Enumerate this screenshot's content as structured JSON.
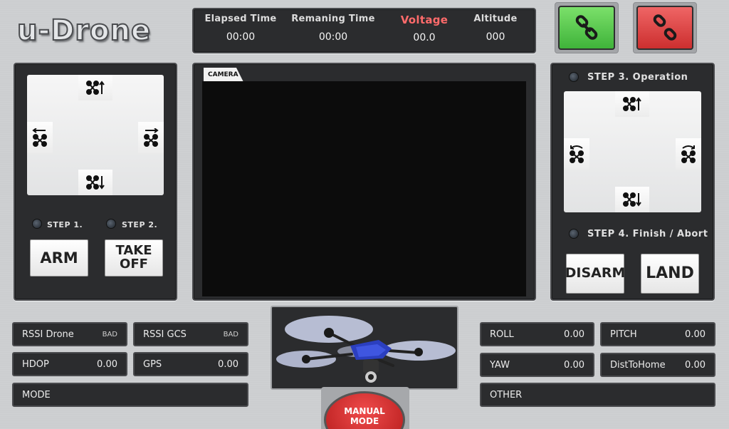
{
  "app": {
    "title": "u-Drone"
  },
  "stats": [
    {
      "label": "Elapsed Time",
      "value": "00:00"
    },
    {
      "label": "Remaning Time",
      "value": "00:00"
    },
    {
      "label": "Voltage",
      "value": "00.0"
    },
    {
      "label": "Altitude",
      "value": "000"
    }
  ],
  "link_buttons": {
    "connect_icon": "link-icon",
    "disconnect_icon": "unlink-icon",
    "connect_color": "#4fc444",
    "disconnect_color": "#d83a3a"
  },
  "left_panel": {
    "step1": "STEP 1.",
    "step2": "STEP 2.",
    "arm": "ARM",
    "takeoff_line1": "TAKE",
    "takeoff_line2": "OFF"
  },
  "camera": {
    "tab": "CAMERA"
  },
  "right_panel": {
    "step3": "STEP 3. Operation",
    "step4": "STEP 4. Finish / Abort",
    "disarm": "DISARM",
    "land": "LAND"
  },
  "telemetry_left": {
    "rssi_drone": {
      "label": "RSSI Drone",
      "value": "BAD"
    },
    "rssi_gcs": {
      "label": "RSSI GCS",
      "value": "BAD"
    },
    "hdop": {
      "label": "HDOP",
      "value": "0.00"
    },
    "gps": {
      "label": "GPS",
      "value": "0.00"
    },
    "mode": {
      "label": "MODE",
      "value": ""
    }
  },
  "telemetry_right": {
    "roll": {
      "label": "ROLL",
      "value": "0.00"
    },
    "pitch": {
      "label": "PITCH",
      "value": "0.00"
    },
    "yaw": {
      "label": "YAW",
      "value": "0.00"
    },
    "dist": {
      "label": "DistToHome",
      "value": "0.00"
    },
    "other": {
      "label": "OTHER",
      "value": ""
    }
  },
  "manual_mode": {
    "line1": "MANUAL",
    "line2": "MODE"
  }
}
